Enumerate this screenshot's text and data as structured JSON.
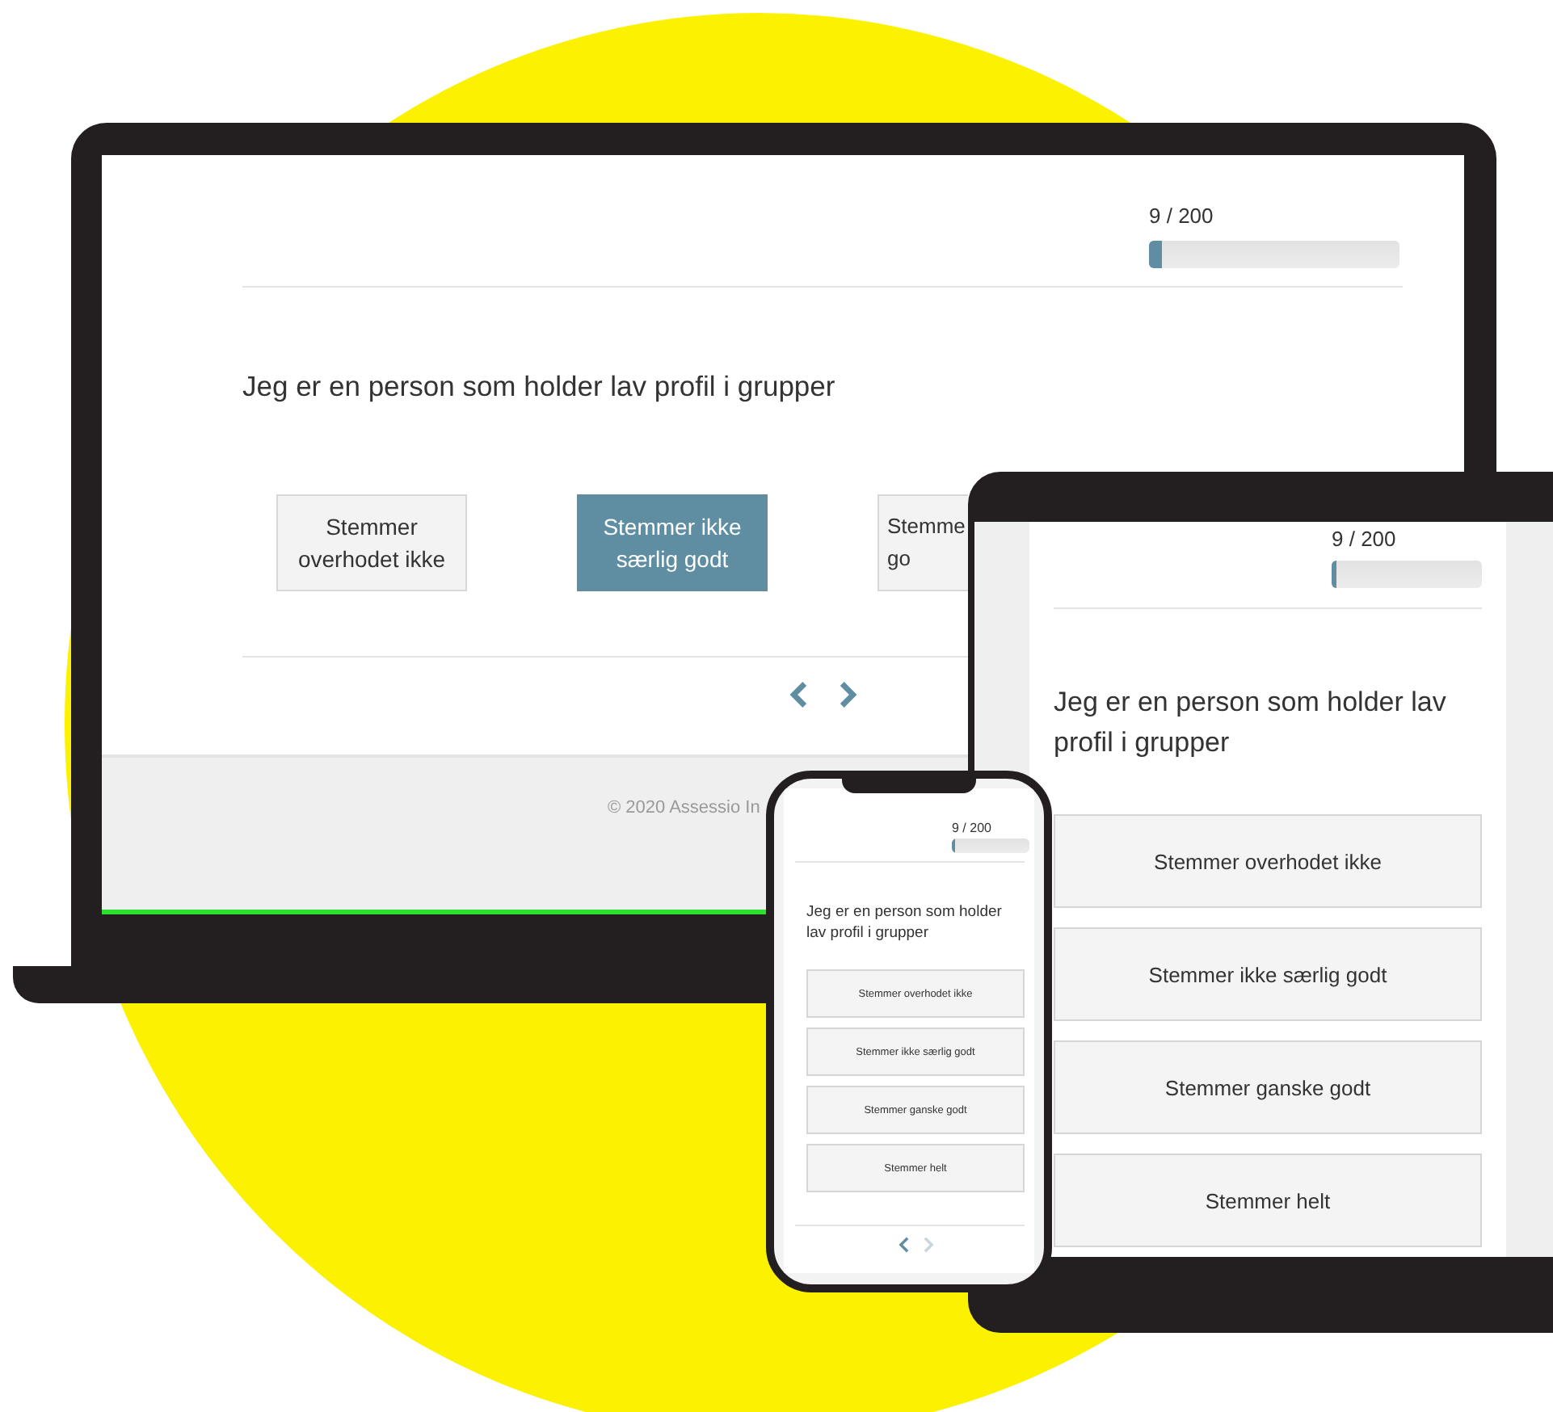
{
  "laptop": {
    "progress": {
      "text": "9 / 200",
      "level": 0.05
    },
    "question": "Jeg er en person som holder lav profil i grupper",
    "answers": [
      {
        "kind": "full",
        "lines": [
          "Stemmer",
          "overhodet ikke"
        ],
        "selected": false
      },
      {
        "kind": "full",
        "lines": [
          "Stemmer ikke",
          "særlig godt"
        ],
        "selected": true
      },
      {
        "kind": "cut",
        "lines": [
          "Stemme",
          "go"
        ],
        "selected": false
      }
    ],
    "nav": {
      "prev_disabled": false,
      "next_disabled": false
    },
    "footer": "© 2020 Assessio In"
  },
  "tablet": {
    "progress": {
      "text": "9 / 200",
      "level": 0.03
    },
    "question": "Jeg er en person som holder lav profil i grupper",
    "answers": [
      {
        "label": "Stemmer overhodet ikke",
        "selected": false
      },
      {
        "label": "Stemmer ikke særlig godt",
        "selected": false
      },
      {
        "label": "Stemmer ganske godt",
        "selected": false
      },
      {
        "label": "Stemmer helt",
        "selected": false
      }
    ]
  },
  "phone": {
    "progress": {
      "text": "9 / 200",
      "level": 0.05
    },
    "question": "Jeg er en person som holder lav profil i grupper",
    "answers": [
      {
        "label": "Stemmer overhodet ikke",
        "selected": false
      },
      {
        "label": "Stemmer ikke særlig godt",
        "selected": false
      },
      {
        "label": "Stemmer ganske godt",
        "selected": false
      },
      {
        "label": "Stemmer helt",
        "selected": false
      }
    ],
    "nav": {
      "prev_disabled": false,
      "next_disabled": true
    }
  }
}
